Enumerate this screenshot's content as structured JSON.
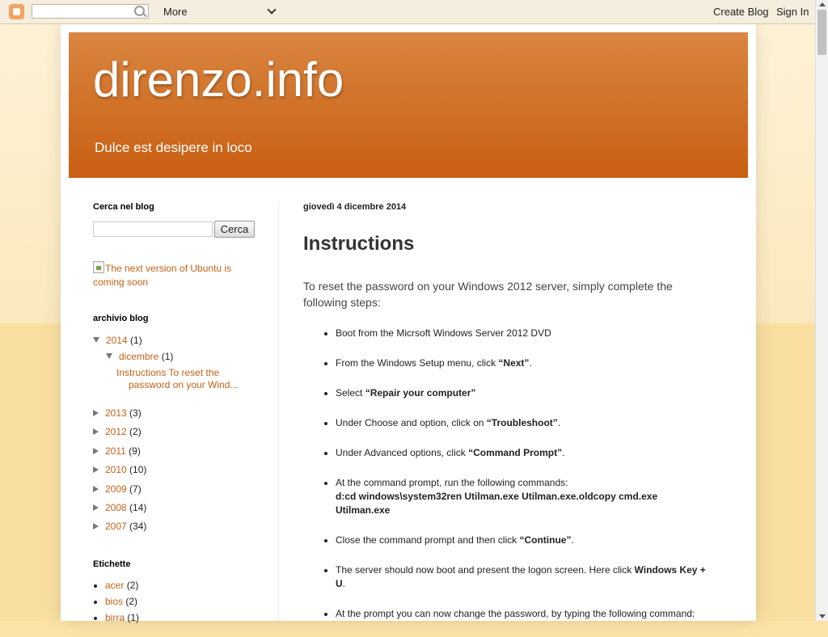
{
  "navbar": {
    "more_label": "More",
    "create_blog_label": "Create Blog",
    "sign_in_label": "Sign In"
  },
  "header": {
    "title": "direnzo.info",
    "description": "Dulce est desipere in loco"
  },
  "sidebar": {
    "search": {
      "title": "Cerca nel blog",
      "button_label": "Cerca"
    },
    "image_alt": "The next version of Ubuntu is coming soon",
    "archive": {
      "title": "archivio blog",
      "expanded_year": {
        "year": "2014",
        "count": "(1)"
      },
      "expanded_month": {
        "month": "dicembre",
        "count": "(1)"
      },
      "post_line1": "Instructions To reset the",
      "post_line2": "password on your Wind...",
      "years": [
        {
          "year": "2013",
          "count": "(3)"
        },
        {
          "year": "2012",
          "count": "(2)"
        },
        {
          "year": "2011",
          "count": "(9)"
        },
        {
          "year": "2010",
          "count": "(10)"
        },
        {
          "year": "2009",
          "count": "(7)"
        },
        {
          "year": "2008",
          "count": "(14)"
        },
        {
          "year": "2007",
          "count": "(34)"
        }
      ]
    },
    "labels": {
      "title": "Etichette",
      "items": [
        {
          "name": "acer",
          "count": "(2)"
        },
        {
          "name": "bios",
          "count": "(2)"
        },
        {
          "name": "birra",
          "count": "(1)"
        }
      ]
    }
  },
  "post": {
    "date": "giovedì 4 dicembre 2014",
    "title": "Instructions",
    "intro": "To reset the password on your Windows 2012 server, simply complete the following steps:",
    "steps": [
      {
        "text": "Boot from the Micrsoft Windows Server 2012 DVD",
        "bold": "",
        "after": ""
      },
      {
        "text": "From the Windows Setup menu, click ",
        "bold": "“Next”",
        "after": "."
      },
      {
        "text": "Select ",
        "bold": "“Repair your computer”",
        "after": ""
      },
      {
        "text": "Under Choose and option, click on ",
        "bold": "“Troubleshoot”",
        "after": "."
      },
      {
        "text": "Under Advanced options, click ",
        "bold": "“Command Prompt”",
        "after": "."
      },
      {
        "text": "At the command prompt, run the following commands:",
        "bold": "d:cd windows\\system32ren Utilman.exe Utilman.exe.oldcopy cmd.exe Utilman.exe",
        "after": ""
      },
      {
        "text": "Close the command prompt and then click ",
        "bold": "“Continue”",
        "after": "."
      },
      {
        "text": "The server should now boot and present the logon screen. Here click ",
        "bold": "Windows Key + U",
        "after": "."
      },
      {
        "text": "At the prompt you can now change the password, by typing the following command:",
        "bold": "",
        "after": ""
      }
    ]
  },
  "colors": {
    "header_top": "#d98540",
    "header_bottom": "#c95f12",
    "link": "#c36217",
    "background": "#fbe3a8"
  }
}
